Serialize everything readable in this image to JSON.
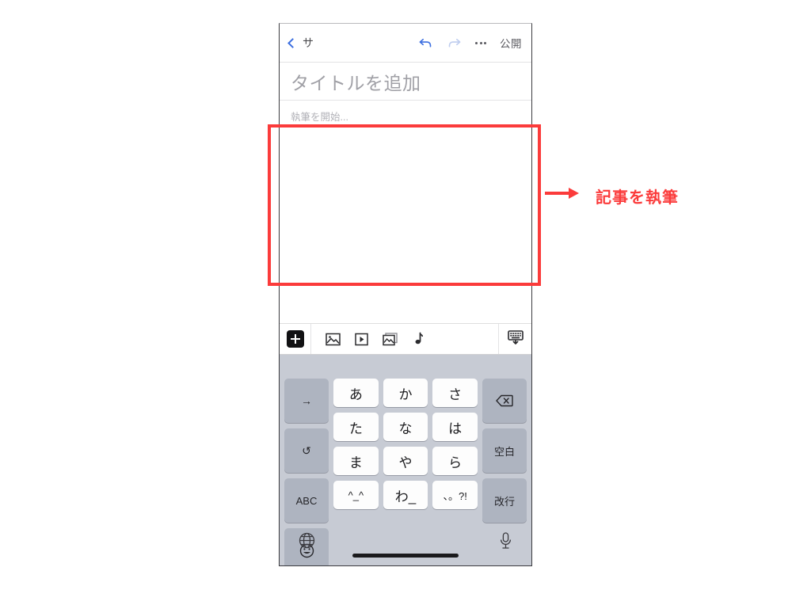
{
  "annotation": {
    "label": "記事を執筆",
    "color": "#fb3b3b",
    "arrow": "right-arrow-icon"
  },
  "phone": {
    "navbar": {
      "back_icon": "chevron-left-icon",
      "back_label": "サ",
      "undo_icon": "undo-arrow-icon",
      "redo_icon": "redo-arrow-icon",
      "more_icon": "ellipsis-icon",
      "publish_label": "公開",
      "undo_color": "#3b6ee0",
      "redo_color": "#b8c8ee"
    },
    "editor": {
      "title_placeholder": "タイトルを追加",
      "title_value": "",
      "body_placeholder": "執筆を開始...",
      "body_value": ""
    },
    "toolbar": {
      "add_icon": "plus-icon",
      "items": [
        {
          "icon": "image-icon"
        },
        {
          "icon": "video-icon"
        },
        {
          "icon": "gallery-icon"
        },
        {
          "icon": "audio-note-icon"
        }
      ],
      "dismiss_icon": "keyboard-dismiss-icon"
    },
    "keyboard": {
      "type": "japanese-kana-flick",
      "rows": [
        {
          "left": {
            "label": "→",
            "name": "cursor-right-key"
          },
          "kana": [
            "あ",
            "か",
            "さ"
          ],
          "right": {
            "label": "⌫",
            "name": "backspace-key"
          }
        },
        {
          "left": {
            "label": "↺",
            "name": "undo-key"
          },
          "kana": [
            "た",
            "な",
            "は"
          ],
          "right": {
            "label": "空白",
            "name": "space-key"
          }
        },
        {
          "left": {
            "label": "ABC",
            "name": "abc-mode-key"
          },
          "kana": [
            "ま",
            "や",
            "ら"
          ],
          "right": {
            "label": "改行",
            "name": "return-key"
          }
        },
        {
          "left": {
            "label": "☺",
            "name": "emoji-key"
          },
          "kana": [
            "^_^",
            "わ_",
            "、。?!"
          ],
          "right": null
        }
      ],
      "bottom": {
        "globe_icon": "globe-icon",
        "mic_icon": "microphone-icon",
        "home_indicator": "home-indicator"
      },
      "colors": {
        "background": "#c7cbd4",
        "kana_key": "#fdfdfd",
        "function_key": "#aeb4c0"
      }
    }
  }
}
